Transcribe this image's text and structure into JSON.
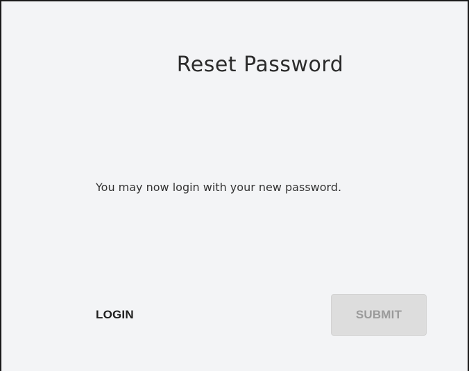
{
  "page": {
    "title": "Reset Password",
    "message": "You may now login with your new password."
  },
  "actions": {
    "login_label": "LOGIN",
    "submit_label": "SUBMIT",
    "submit_disabled": true
  },
  "colors": {
    "background": "#f3f4f6",
    "submit_bg": "#dddddd",
    "submit_text": "#9b9b9b"
  }
}
